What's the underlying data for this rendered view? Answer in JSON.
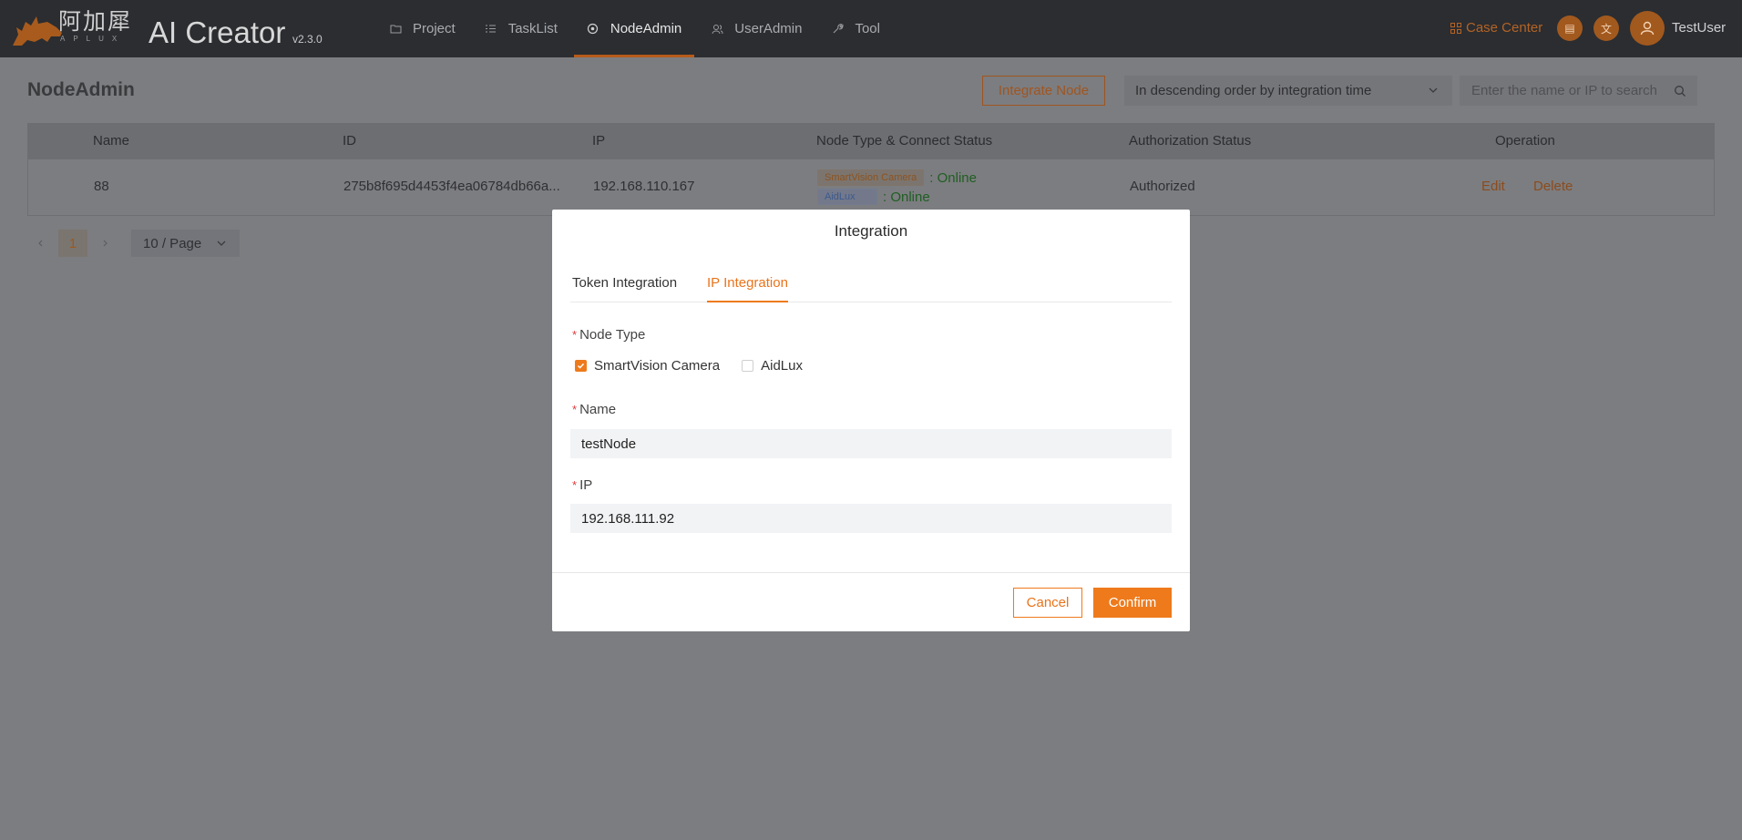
{
  "header": {
    "logo_cn": "阿加犀",
    "logo_sub": "APLUX",
    "app_title": "AI Creator",
    "version": "v2.3.0",
    "nav": [
      {
        "label": "Project",
        "icon": "folder-icon"
      },
      {
        "label": "TaskList",
        "icon": "list-icon"
      },
      {
        "label": "NodeAdmin",
        "icon": "node-icon",
        "active": true
      },
      {
        "label": "UserAdmin",
        "icon": "users-icon"
      },
      {
        "label": "Tool",
        "icon": "tool-icon"
      }
    ],
    "case_center": "Case Center",
    "username": "TestUser"
  },
  "page": {
    "title": "NodeAdmin",
    "integrate_button": "Integrate Node",
    "sort_value": "In descending order by integration time",
    "search_placeholder": "Enter the name or IP to search"
  },
  "table": {
    "columns": [
      "Name",
      "ID",
      "IP",
      "Node Type & Connect Status",
      "Authorization Status",
      "Operation"
    ],
    "rows": [
      {
        "name": "88",
        "id": "275b8f695d4453f4ea06784db66a...",
        "ip": "192.168.110.167",
        "types": [
          {
            "tag": "SmartVision Camera",
            "status": "Online"
          },
          {
            "tag": "AidLux",
            "status": "Online"
          }
        ],
        "authorization": "Authorized",
        "edit": "Edit",
        "delete": "Delete"
      }
    ]
  },
  "pagination": {
    "current_page": "1",
    "page_size": "10 / Page"
  },
  "modal": {
    "title": "Integration",
    "tabs": [
      "Token Integration",
      "IP Integration"
    ],
    "active_tab": "IP Integration",
    "node_type_label": "Node Type",
    "options": [
      {
        "label": "SmartVision Camera",
        "checked": true
      },
      {
        "label": "AidLux",
        "checked": false
      }
    ],
    "name_label": "Name",
    "name_value": "testNode",
    "ip_label": "IP",
    "ip_value": "192.168.111.92",
    "cancel": "Cancel",
    "confirm": "Confirm"
  },
  "colors": {
    "accent": "#ee7a1c",
    "topbar": "#2b2d31",
    "online": "#1f5e22",
    "required": "#e23b3b"
  }
}
